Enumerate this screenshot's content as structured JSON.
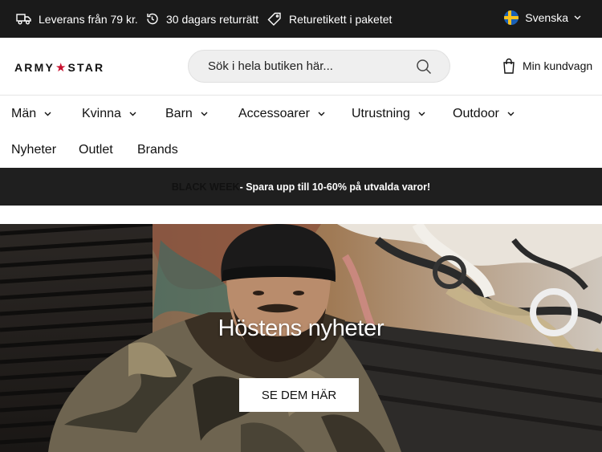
{
  "topbar": {
    "usps": [
      {
        "icon": "truck-icon",
        "label": "Leverans från 79 kr."
      },
      {
        "icon": "return-arrow-icon",
        "label": "30 dagars returrätt"
      },
      {
        "icon": "tag-icon",
        "label": "Returetikett i paketet"
      }
    ],
    "language": {
      "icon": "sweden-flag-icon",
      "label": "Svenska"
    }
  },
  "header": {
    "logo": {
      "left": "ARMY",
      "star": "★",
      "right": "STAR"
    },
    "search_placeholder": "Sök i hela butiken här...",
    "cart_label": "Min kundvagn"
  },
  "nav": {
    "items": [
      {
        "label": "Män",
        "has_dropdown": true
      },
      {
        "label": "Kvinna",
        "has_dropdown": true
      },
      {
        "label": "Barn",
        "has_dropdown": true
      },
      {
        "label": "Accessoarer",
        "has_dropdown": true
      },
      {
        "label": "Utrustning",
        "has_dropdown": true
      },
      {
        "label": "Outdoor",
        "has_dropdown": true
      },
      {
        "label": "Nyheter",
        "has_dropdown": false
      },
      {
        "label": "Outlet",
        "has_dropdown": false
      },
      {
        "label": "Brands",
        "has_dropdown": false
      }
    ]
  },
  "promo": {
    "highlight": "BLACK WEEK",
    "text": " - Spara upp till 10-60% på utvalda varor!"
  },
  "hero": {
    "title": "Höstens nyheter",
    "button_label": "SE DEM HÄR"
  },
  "colors": {
    "topbar_bg": "#1a1a1a",
    "promo_bg": "#1f1f1f",
    "logo_star": "#c8102e",
    "search_bg": "#efefef"
  }
}
